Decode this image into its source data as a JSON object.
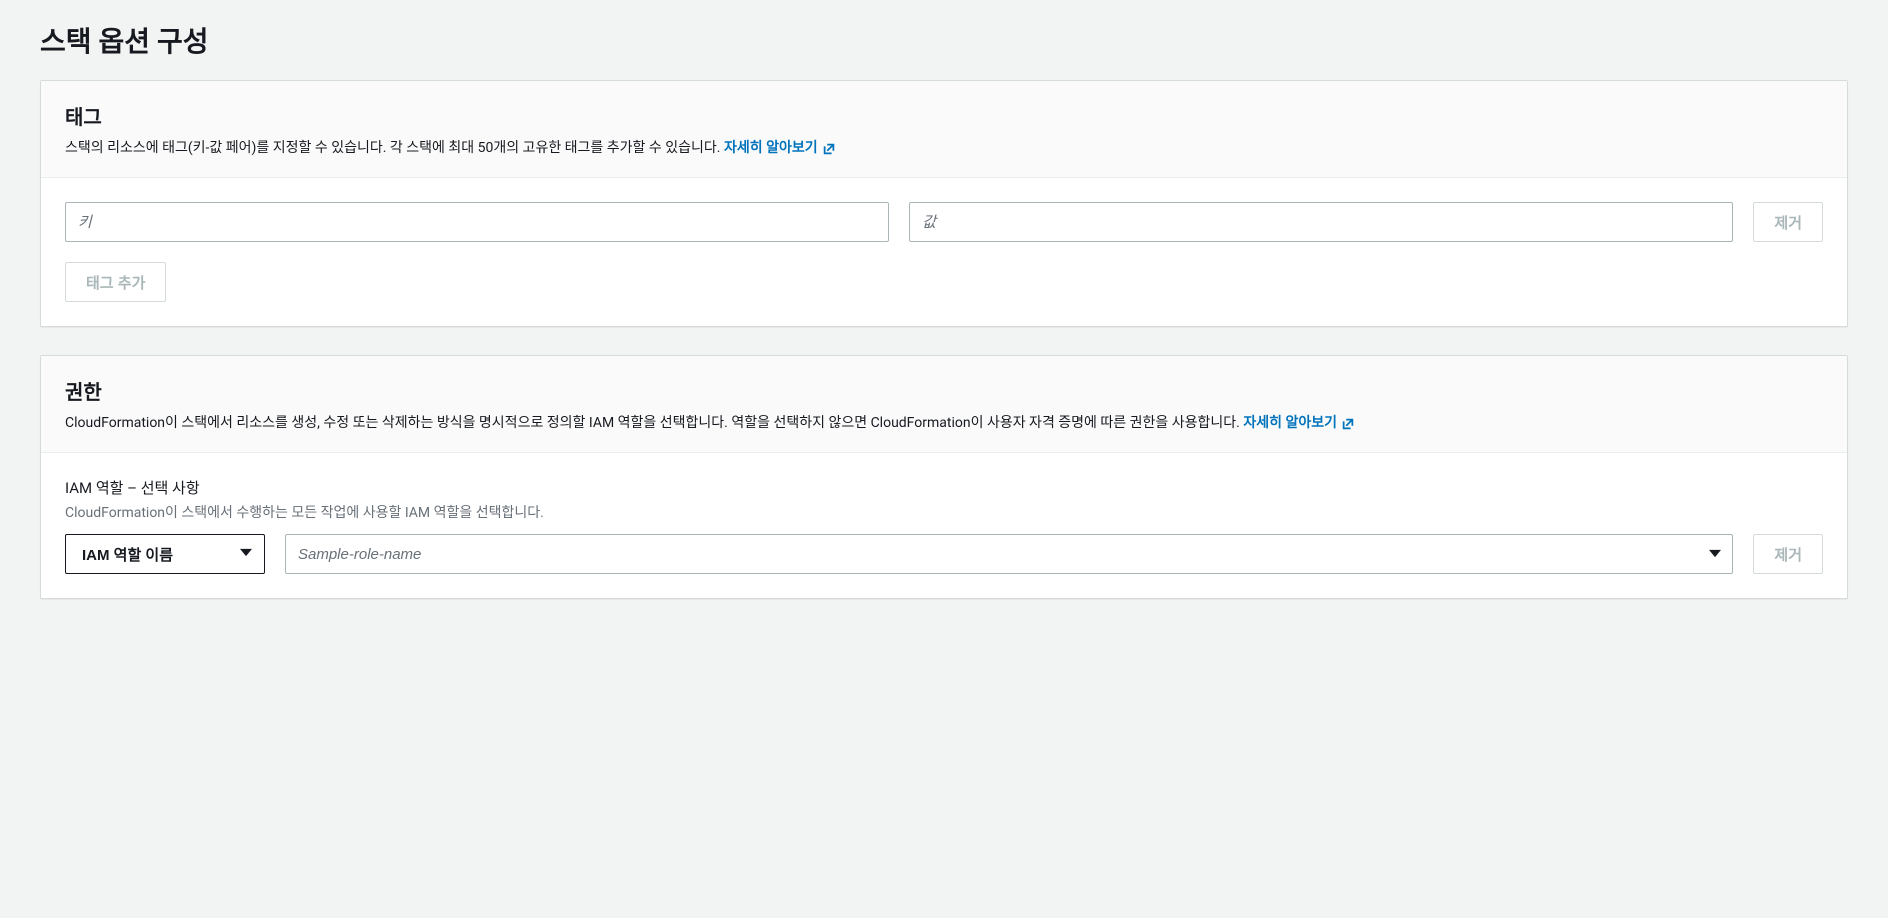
{
  "page": {
    "title": "스택 옵션 구성"
  },
  "tags": {
    "title": "태그",
    "description": "스택의 리소스에 태그(키-값 페어)를 지정할 수 있습니다. 각 스택에 최대 50개의 고유한 태그를 추가할 수 있습니다.",
    "learn_more": "자세히 알아보기",
    "key_placeholder": "키",
    "value_placeholder": "값",
    "remove_label": "제거",
    "add_label": "태그 추가"
  },
  "permissions": {
    "title": "권한",
    "description": "CloudFormation이 스택에서 리소스를 생성, 수정 또는 삭제하는 방식을 명시적으로 정의할 IAM 역할을 선택합니다. 역할을 선택하지 않으면 CloudFormation이 사용자 자격 증명에 따른 권한을 사용합니다.",
    "learn_more": "자세히 알아보기",
    "field_label": "IAM 역할 – 선택 사항",
    "field_hint": "CloudFormation이 스택에서 수행하는 모든 작업에 사용할 IAM 역할을 선택합니다.",
    "select_label": "IAM 역할 이름",
    "role_placeholder": "Sample-role-name",
    "remove_label": "제거"
  }
}
